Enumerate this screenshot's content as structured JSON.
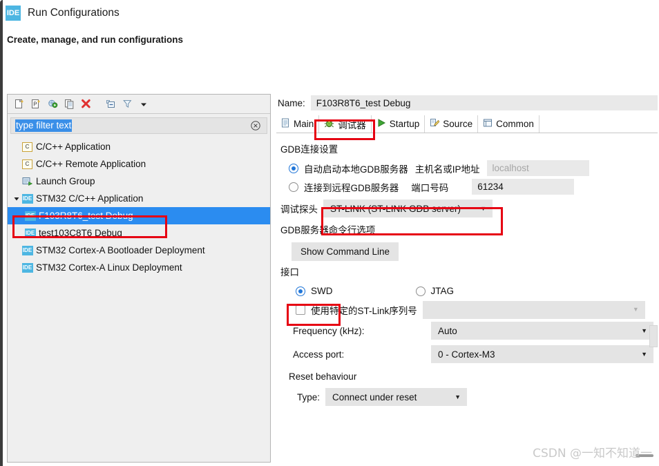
{
  "window": {
    "title": "Run Configurations",
    "app_icon": "IDE",
    "subtitle": "Create, manage, and run configurations"
  },
  "left_panel": {
    "toolbar": [
      {
        "name": "new-configuration-icon",
        "tip": "New launch configuration"
      },
      {
        "name": "new-prototype-icon",
        "tip": "New prototype"
      },
      {
        "name": "export-icon",
        "tip": "Export"
      },
      {
        "name": "duplicate-icon",
        "tip": "Duplicate"
      },
      {
        "name": "delete-icon",
        "tip": "Delete"
      },
      {
        "name": "collapse-all-icon",
        "tip": "Collapse All"
      },
      {
        "name": "filter-icon",
        "tip": "Filter"
      },
      {
        "name": "view-menu-icon",
        "tip": "View Menu"
      }
    ],
    "filter": {
      "value": "type filter text",
      "selected": true,
      "clear_icon": "clear-icon"
    },
    "tree": [
      {
        "label": "C/C++ Application",
        "icon": "c-app-icon",
        "indent": 0,
        "expandable": false,
        "selected": false
      },
      {
        "label": "C/C++ Remote Application",
        "icon": "c-app-icon",
        "indent": 0,
        "expandable": false,
        "selected": false
      },
      {
        "label": "Launch Group",
        "icon": "launch-group-icon",
        "indent": 0,
        "expandable": false,
        "selected": false
      },
      {
        "label": "STM32 C/C++ Application",
        "icon": "ide-icon",
        "indent": 0,
        "expandable": true,
        "expanded": true,
        "selected": false
      },
      {
        "label": "F103R8T6_test Debug",
        "icon": "ide-icon",
        "indent": 1,
        "expandable": false,
        "selected": true
      },
      {
        "label": "test103C8T6 Debug",
        "icon": "ide-icon",
        "indent": 1,
        "expandable": false,
        "selected": false
      },
      {
        "label": "STM32 Cortex-A Bootloader Deployment",
        "icon": "ide-icon",
        "indent": 0,
        "expandable": false,
        "selected": false
      },
      {
        "label": "STM32 Cortex-A Linux Deployment",
        "icon": "ide-icon",
        "indent": 0,
        "expandable": false,
        "selected": false
      }
    ]
  },
  "right_panel": {
    "name_label": "Name:",
    "name_value": "F103R8T6_test Debug",
    "tabs": [
      {
        "label": "Main",
        "icon": "document-icon",
        "active": false
      },
      {
        "label": "调试器",
        "icon": "debugger-bug-icon",
        "active": true
      },
      {
        "label": "Startup",
        "icon": "run-play-icon",
        "active": false
      },
      {
        "label": "Source",
        "icon": "source-edit-icon",
        "active": false
      },
      {
        "label": "Common",
        "icon": "common-table-icon",
        "active": false
      }
    ],
    "gdb_connection": {
      "group_label": "GDB连接设置",
      "auto_start_label": "自动启动本地GDB服务器",
      "auto_start_checked": true,
      "host_label": "主机名或IP地址",
      "host_placeholder": "localhost",
      "remote_label": "连接到远程GDB服务器",
      "remote_checked": false,
      "port_label": "端口号码",
      "port_value": "61234"
    },
    "debug_probe": {
      "label": "调试探头",
      "value": "ST-LINK (ST-LINK GDB server)"
    },
    "gdb_server_options": {
      "group_label": "GDB服务器命令行选项",
      "show_command_line_button": "Show Command Line"
    },
    "interface": {
      "group_label": "接口",
      "swd_label": "SWD",
      "swd_checked": true,
      "jtag_label": "JTAG",
      "jtag_checked": false,
      "use_serial_label": "使用特定的ST-Link序列号",
      "use_serial_checked": false,
      "serial_value": "",
      "frequency_label": "Frequency (kHz):",
      "frequency_value": "Auto",
      "access_port_label": "Access port:",
      "access_port_value": "0 - Cortex-M3"
    },
    "reset_behaviour": {
      "group_label": "Reset behaviour",
      "type_label": "Type:",
      "type_value": "Connect under reset"
    }
  },
  "watermark": "CSDN @一知不知道一",
  "colors": {
    "accent_blue": "#2b8cf0",
    "annotation_red": "#e60012",
    "ide_badge": "#4db6e2",
    "panel_bg": "#efefef",
    "field_bg": "#e4e4e4"
  }
}
